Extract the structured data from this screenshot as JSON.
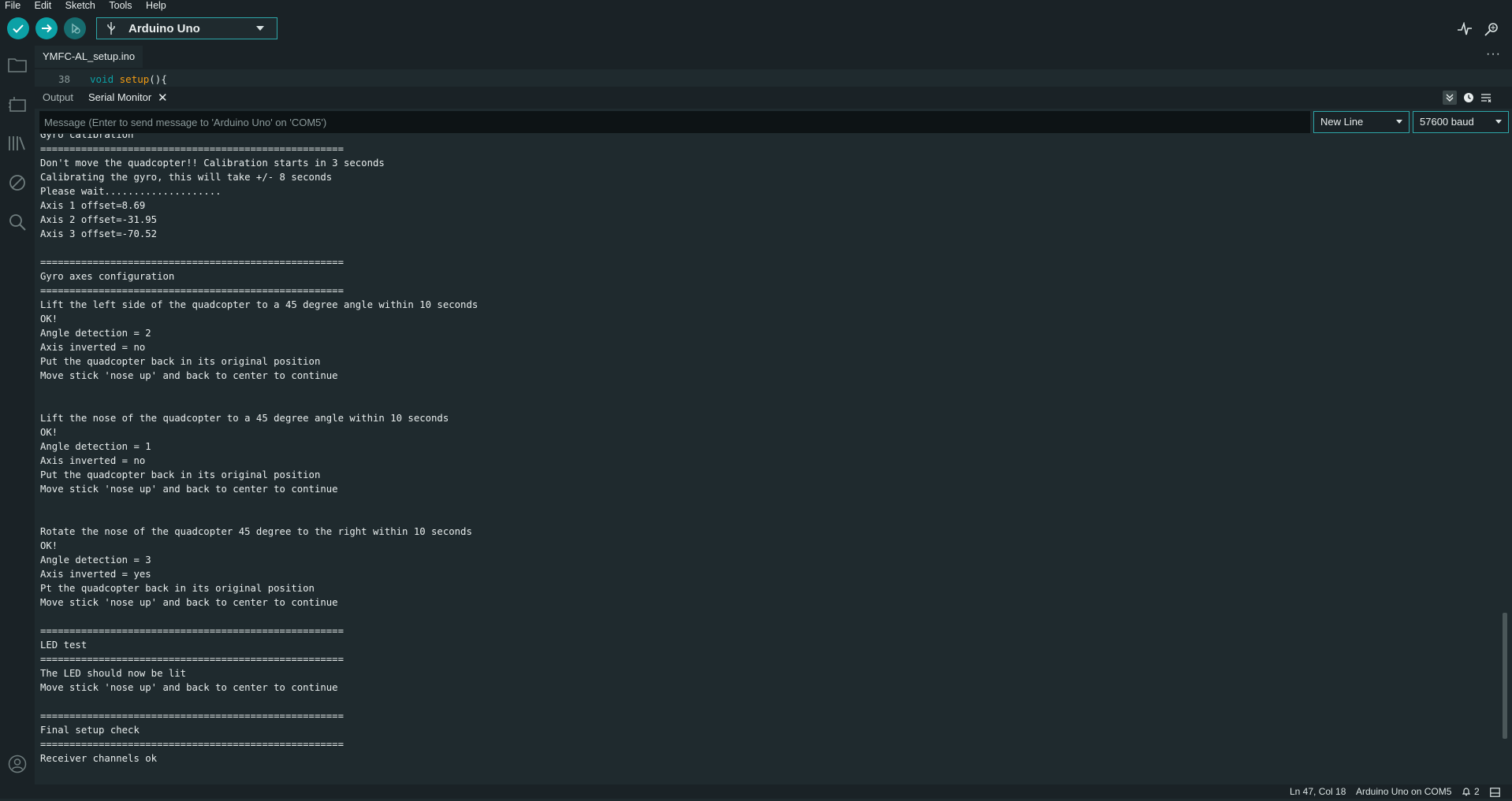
{
  "menu": [
    "File",
    "Edit",
    "Sketch",
    "Tools",
    "Help"
  ],
  "toolbar": {
    "verify_icon": "check-icon",
    "upload_icon": "arrow-right-icon",
    "debug_icon": "debug-icon",
    "board": "Arduino Uno",
    "serial_plotter_icon": "pulse-icon",
    "serial_monitor_icon": "magnifier-icon"
  },
  "activity": [
    "folder-icon",
    "board-icon",
    "library-icon",
    "debug-off-icon",
    "search-icon",
    "account-icon"
  ],
  "editor": {
    "file_tab": "YMFC-AL_setup.ino",
    "more": "···",
    "line_number": "38",
    "code_keyword": "void",
    "code_function": "setup",
    "code_rest": "(){"
  },
  "panel": {
    "tab_output": "Output",
    "tab_serial": "Serial Monitor",
    "close": "✕",
    "message_placeholder": "Message (Enter to send message to 'Arduino Uno' on 'COM5')",
    "line_ending": "New Line",
    "baud": "57600 baud"
  },
  "serial_lines": [
    "Gyro calibration",
    "====================================================",
    "Don't move the quadcopter!! Calibration starts in 3 seconds",
    "Calibrating the gyro, this will take +/- 8 seconds",
    "Please wait....................",
    "Axis 1 offset=8.69",
    "Axis 2 offset=-31.95",
    "Axis 3 offset=-70.52",
    "",
    "====================================================",
    "Gyro axes configuration",
    "====================================================",
    "Lift the left side of the quadcopter to a 45 degree angle within 10 seconds",
    "OK!",
    "Angle detection = 2",
    "Axis inverted = no",
    "Put the quadcopter back in its original position",
    "Move stick 'nose up' and back to center to continue",
    "",
    "",
    "Lift the nose of the quadcopter to a 45 degree angle within 10 seconds",
    "OK!",
    "Angle detection = 1",
    "Axis inverted = no",
    "Put the quadcopter back in its original position",
    "Move stick 'nose up' and back to center to continue",
    "",
    "",
    "Rotate the nose of the quadcopter 45 degree to the right within 10 seconds",
    "OK!",
    "Angle detection = 3",
    "Axis inverted = yes",
    "Pt the quadcopter back in its original position",
    "Move stick 'nose up' and back to center to continue",
    "",
    "====================================================",
    "LED test",
    "====================================================",
    "The LED should now be lit",
    "Move stick 'nose up' and back to center to continue",
    "",
    "====================================================",
    "Final setup check",
    "====================================================",
    "Receiver channels ok"
  ],
  "status": {
    "position": "Ln 47, Col 18",
    "board_port": "Arduino Uno on COM5",
    "notifications": "2"
  },
  "colors": {
    "accent": "#2ea6a8",
    "background": "#1f2a2e",
    "chrome": "#1a2226",
    "input": "#0d1315"
  }
}
